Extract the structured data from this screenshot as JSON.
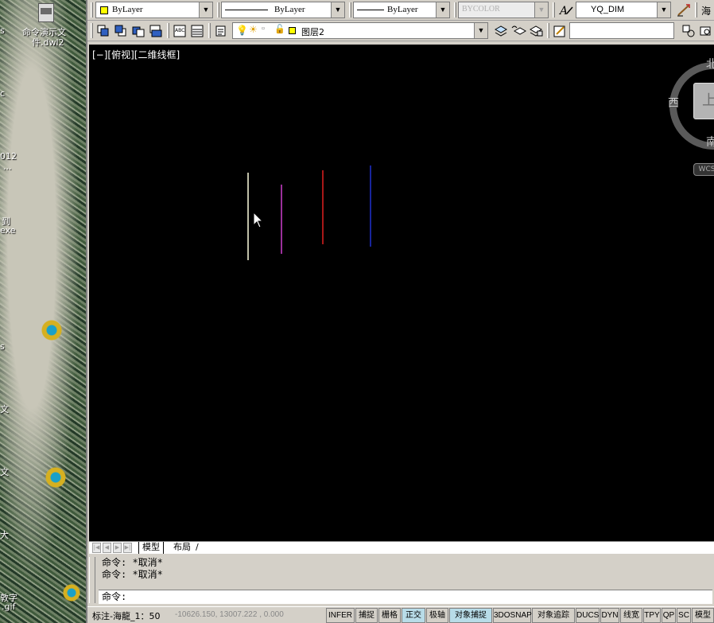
{
  "desktop": {
    "icon_label_line1": "命令演示文",
    "icon_label_line2": "件.dwl2",
    "fragments": {
      "f1": "s",
      "f2": "c",
      "f3": "012",
      "f4": "...",
      "f5": "到",
      "f6": "exe",
      "f7": "s",
      "f8": "文",
      "f9": "文",
      "f10": "大",
      "f11": "敦字",
      "f12": ".gif"
    }
  },
  "toolbar1": {
    "color_value": "ByLayer",
    "linetype_value": "ByLayer",
    "lineweight_value": "ByLayer",
    "plotstyle_value": "BYCOLOR",
    "dimstyle_value": "YQ_DIM",
    "cutoff_text": "海"
  },
  "toolbar2": {
    "layer_value": "图层2"
  },
  "canvas": {
    "view_label": "[−][俯视][二维线框]",
    "lines": [
      {
        "color": "#ffffe0"
      },
      {
        "color": "#d040d0"
      },
      {
        "color": "#e02020"
      },
      {
        "color": "#2030d0"
      }
    ]
  },
  "viewcube": {
    "north": "北",
    "west": "西",
    "south": "南",
    "face": "上",
    "wcs": "WCS"
  },
  "tabs": {
    "model": "模型",
    "layout": "布局",
    "separator": "/"
  },
  "command": {
    "history": [
      "命令: *取消*",
      "命令: *取消*"
    ],
    "prompt": "命令:"
  },
  "status": {
    "annotation_scale": "标注-海龍_1：50",
    "coordinates": "-10626.150, 13007.222 , 0.000",
    "buttons": [
      {
        "label": "INFER",
        "on": false
      },
      {
        "label": "捕捉",
        "on": false
      },
      {
        "label": "栅格",
        "on": false
      },
      {
        "label": "正交",
        "on": true
      },
      {
        "label": "极轴",
        "on": false
      },
      {
        "label": "对象捕捉",
        "on": true
      },
      {
        "label": "3DOSNAP",
        "on": false
      },
      {
        "label": "对象追踪",
        "on": false
      },
      {
        "label": "DUCS",
        "on": false
      },
      {
        "label": "DYN",
        "on": false
      },
      {
        "label": "线宽",
        "on": false
      },
      {
        "label": "TPY",
        "on": false
      },
      {
        "label": "QP",
        "on": false
      },
      {
        "label": "SC",
        "on": false
      },
      {
        "label": "模型",
        "on": false
      }
    ]
  }
}
